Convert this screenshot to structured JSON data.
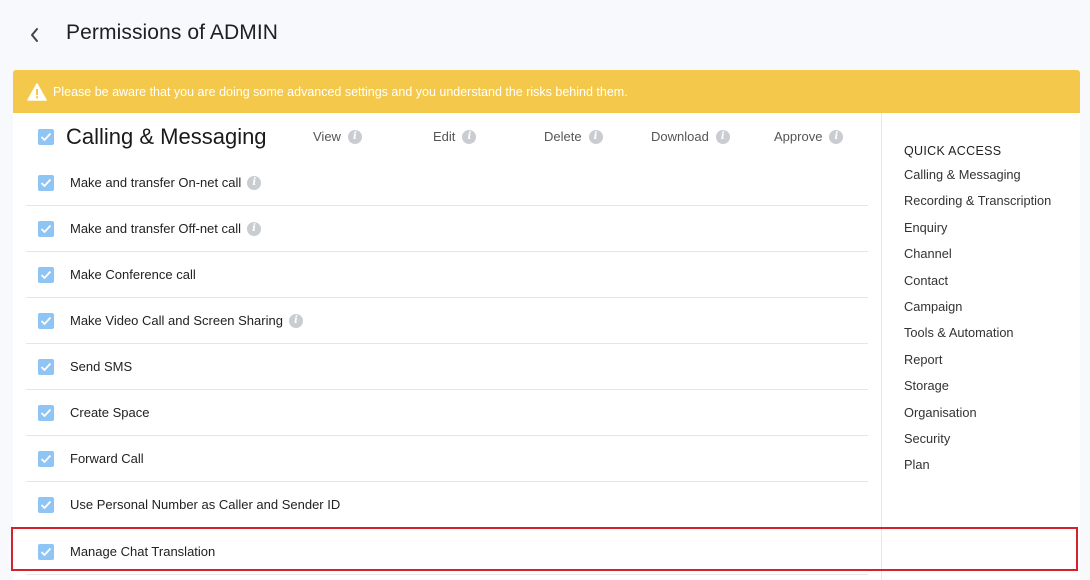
{
  "header": {
    "title": "Permissions of ADMIN"
  },
  "warning": {
    "text": "Please be aware that you are doing some advanced settings and you understand the risks behind them."
  },
  "section": {
    "title": "Calling & Messaging",
    "columns": [
      "View",
      "Edit",
      "Delete",
      "Download",
      "Approve"
    ]
  },
  "permissions": [
    {
      "label": "Make and transfer On-net call",
      "info": true
    },
    {
      "label": "Make and transfer Off-net call",
      "info": true
    },
    {
      "label": "Make Conference call",
      "info": false
    },
    {
      "label": "Make Video Call and Screen Sharing",
      "info": true
    },
    {
      "label": "Send SMS",
      "info": false
    },
    {
      "label": "Create Space",
      "info": false
    },
    {
      "label": "Forward Call",
      "info": false
    },
    {
      "label": "Use Personal Number as Caller and Sender ID",
      "info": false
    },
    {
      "label": "Manage Chat Translation",
      "info": false
    }
  ],
  "quick_access": {
    "title": "QUICK ACCESS",
    "items": [
      "Calling & Messaging",
      "Recording & Transcription",
      "Enquiry",
      "Channel",
      "Contact",
      "Campaign",
      "Tools & Automation",
      "Report",
      "Storage",
      "Organisation",
      "Security",
      "Plan"
    ]
  },
  "colors": {
    "warning": "#f4c84a",
    "checkbox": "#8ec5f5",
    "highlight": "#d2222d"
  }
}
